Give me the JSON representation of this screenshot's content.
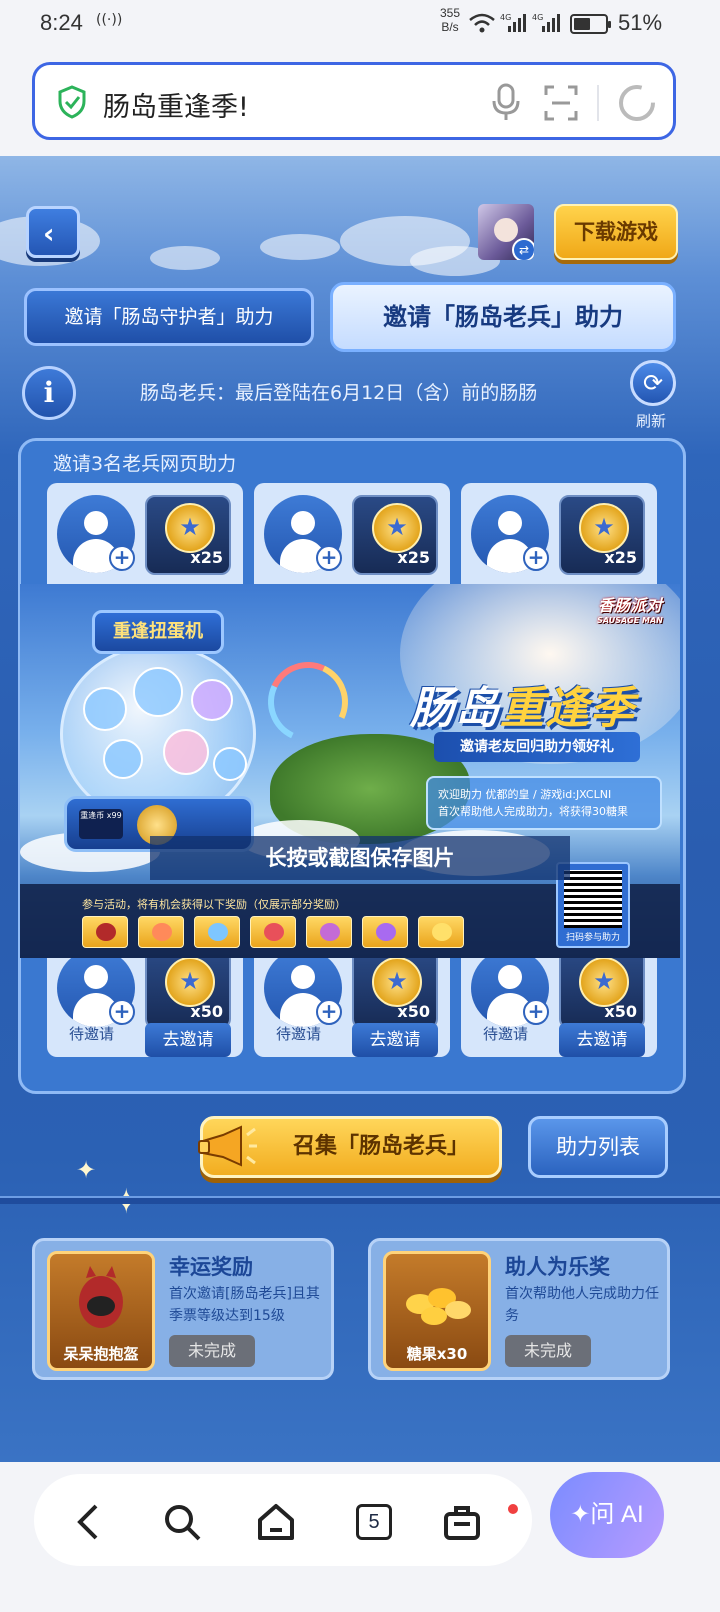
{
  "status_bar": {
    "time": "8:24",
    "speed_value": "355",
    "speed_unit": "B/s",
    "net1": "4G",
    "net2": "4G",
    "battery": "51%"
  },
  "address_bar": {
    "url_text": "肠岛重逢季!"
  },
  "game": {
    "download_label": "下载游戏",
    "tabs": [
      {
        "label": "邀请「肠岛守护者」助力"
      },
      {
        "label": "邀请「肠岛老兵」助力"
      }
    ],
    "info_note": "肠岛老兵：最后登陆在6月12日（含）前的肠肠",
    "refresh_label": "刷新",
    "panel_title": "邀请3名老兵网页助力",
    "top_rewards": [
      {
        "qty": "x25"
      },
      {
        "qty": "x25"
      },
      {
        "qty": "x25"
      }
    ],
    "bottom_slots": [
      {
        "qty": "x50",
        "status": "待邀请",
        "action": "去邀请"
      },
      {
        "qty": "x50",
        "status": "待邀请",
        "action": "去邀请"
      },
      {
        "qty": "x50",
        "status": "待邀请",
        "action": "去邀请"
      }
    ],
    "save_hint": "长按或截图保存图片",
    "cta_label": "召集「肠岛老兵」",
    "list_label": "助力列表",
    "bottom_cards": [
      {
        "image_label": "呆呆抱抱盔",
        "title": "幸运奖励",
        "desc": "首次邀请[肠岛老兵]且其季票等级达到15级",
        "status": "未完成"
      },
      {
        "image_label": "糖果x30",
        "title": "助人为乐奖",
        "desc": "首次帮助他人完成助力任务",
        "status": "未完成"
      }
    ]
  },
  "poster": {
    "machine_title": "重逢扭蛋机",
    "machine_small": "重逢币 x99",
    "logo": "香肠派对",
    "logo_sub": "SAUSAGE MAN",
    "title_part1": "肠岛",
    "title_part2": "重逢季",
    "ribbon": "邀请老友回归助力领好礼",
    "welcome_line1": "欢迎助力 优都的皇 / 游戏id:JXCLNI",
    "welcome_line2": "首次帮助他人完成助力，将获得30糖果",
    "strip_text": "参与活动，将有机会获得以下奖励（仅展示部分奖励）",
    "qr_label": "扫码参与助力"
  },
  "bottom_nav": {
    "tab_count": "5",
    "ai_label": "问 AI"
  },
  "colors": {
    "accent": "#3d66e4",
    "game_blue": "#2a5db0",
    "gold": "#f2ad20"
  }
}
